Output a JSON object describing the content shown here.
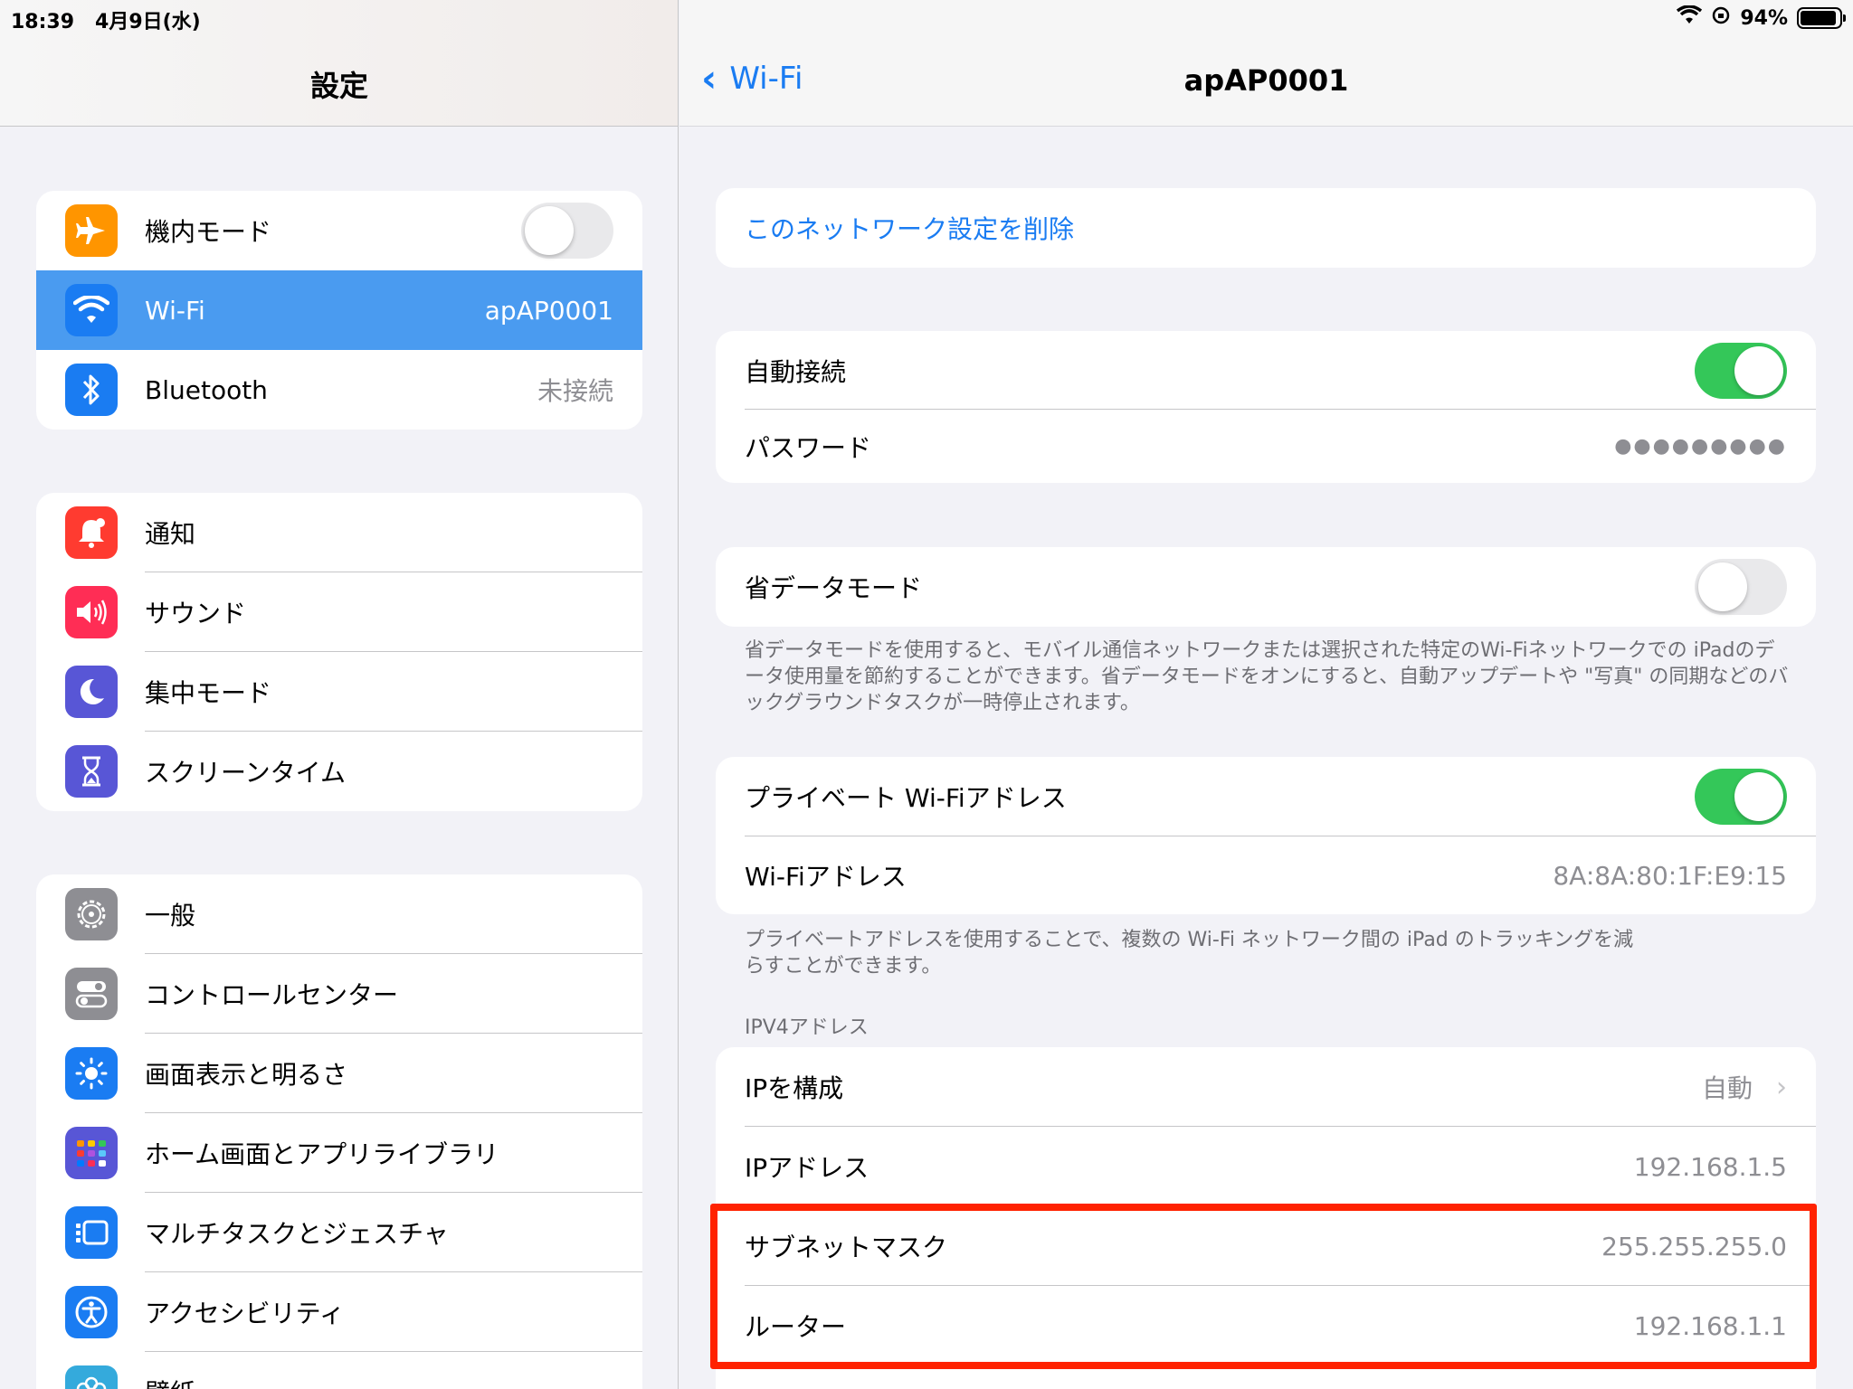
{
  "status": {
    "time": "18:39",
    "date": "4月9日(水)",
    "battery": "94%",
    "battery_level": 0.94
  },
  "sidebar": {
    "title": "設定",
    "group1": [
      {
        "label": "機内モード",
        "icon": "airplane-icon",
        "color": "#ff9500"
      },
      {
        "label": "Wi-Fi",
        "value": "apAP0001",
        "icon": "wifi-icon",
        "color": "#1a7cf2"
      },
      {
        "label": "Bluetooth",
        "value": "未接続",
        "icon": "bluetooth-icon",
        "color": "#1a7cf2"
      }
    ],
    "group2": [
      {
        "label": "通知",
        "icon": "bell-icon",
        "color": "#ff3b30"
      },
      {
        "label": "サウンド",
        "icon": "speaker-icon",
        "color": "#ff2d55"
      },
      {
        "label": "集中モード",
        "icon": "moon-icon",
        "color": "#5856d6"
      },
      {
        "label": "スクリーンタイム",
        "icon": "hourglass-icon",
        "color": "#5856d6"
      }
    ],
    "group3": [
      {
        "label": "一般",
        "icon": "gear-icon",
        "color": "#8e8e93"
      },
      {
        "label": "コントロールセンター",
        "icon": "switches-icon",
        "color": "#8e8e93"
      },
      {
        "label": "画面表示と明るさ",
        "icon": "sun-icon",
        "color": "#1a7cf2"
      },
      {
        "label": "ホーム画面とアプリライブラリ",
        "icon": "grid-icon",
        "color": "#5856d6"
      },
      {
        "label": "マルチタスクとジェスチャ",
        "icon": "multitask-icon",
        "color": "#1a7cf2"
      },
      {
        "label": "アクセシビリティ",
        "icon": "accessibility-icon",
        "color": "#1a7cf2"
      },
      {
        "label": "壁紙",
        "icon": "flower-icon",
        "color": "#34aadc"
      }
    ]
  },
  "detail": {
    "back_label": "Wi-Fi",
    "title": "apAP0001",
    "forget": "このネットワーク設定を削除",
    "auto_join": "自動接続",
    "password": "パスワード",
    "password_value": "●●●●●●●●●",
    "low_data": "省データモード",
    "low_data_footer": "省データモードを使用すると、モバイル通信ネットワークまたは選択された特定のWi-Fiネットワークでの iPadのデータ使用量を節約することができます。省データモードをオンにすると、自動アップデートや \"写真\" の同期などのバックグラウンドタスクが一時停止されます。",
    "private_addr": "プライベート Wi-Fiアドレス",
    "wifi_addr": "Wi-Fiアドレス",
    "wifi_addr_value": "8A:8A:80:1F:E9:15",
    "private_footer": "プライベートアドレスを使用することで、複数の Wi-Fi ネットワーク間の iPad のトラッキングを減らすことができます。",
    "ipv4_header": "IPV4アドレス",
    "configure_ip": "IPを構成",
    "configure_ip_value": "自動",
    "ip_address": "IPアドレス",
    "ip_address_value": "192.168.1.5",
    "subnet": "サブネットマスク",
    "subnet_value": "255.255.255.0",
    "router": "ルーター",
    "router_value": "192.168.1.1"
  },
  "colors": {
    "accent": "#1a7cf2",
    "toggle_on": "#34c759",
    "highlight": "#ff2200"
  }
}
